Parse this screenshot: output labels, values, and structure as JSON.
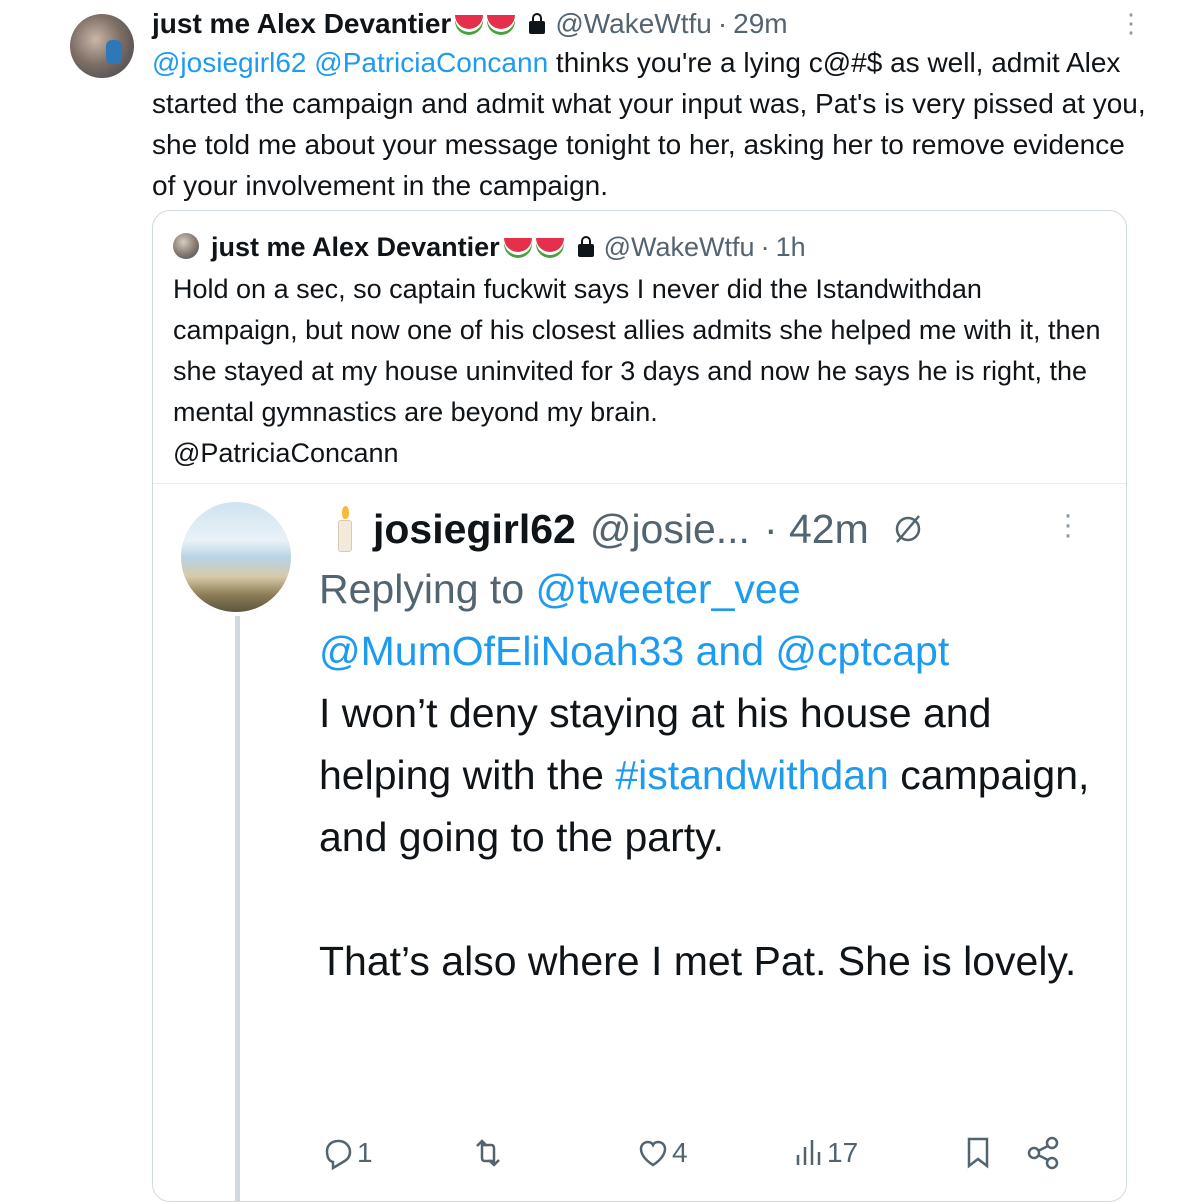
{
  "tweet": {
    "author_name": "just me Alex Devantier",
    "handle": "@WakeWtfu",
    "time_sep": "·",
    "time": "29m",
    "mentions": [
      "@josiegirl62",
      "@PatriciaConcann"
    ],
    "text": " thinks you're a lying c@#$ as well, admit Alex started the campaign and admit what your input was, Pat's is very pissed at you, she told me about your message tonight to her, asking her to remove evidence of your involvement in the campaign."
  },
  "quoted": {
    "author_name": "just me Alex Devantier",
    "handle": "@WakeWtfu",
    "time_sep": "·",
    "time": "1h",
    "text": "Hold on a sec, so captain fuckwit says I never did the Istandwithdan campaign, but now one of his closest allies admits she helped me with it, then she stayed at my house uninvited for 3 days and now he says he is right, the mental gymnastics are beyond my brain.",
    "mention": "@PatriciaConcann"
  },
  "inner": {
    "author_name": "josiegirl62",
    "handle": "@josie...",
    "time": "· 42m",
    "replying_prefix": "Replying to ",
    "replying_1": "@tweeter_vee",
    "replying_2": "@MumOfEliNoah33",
    "replying_and": " and ",
    "replying_3": "@cptcapt",
    "body_part1": "I won’t deny staying at his house and helping with the ",
    "hashtag": "#istandwithdan",
    "body_part2": " campaign, and going to the party.\n\nThat’s also where I met Pat. She is lovely.",
    "actions": {
      "replies": "1",
      "likes": "4",
      "views": "17"
    }
  },
  "icons": [
    "more-vert-icon",
    "lock-icon",
    "watermelon-icon",
    "candle-icon",
    "mute-icon",
    "reply-icon",
    "retweet-icon",
    "like-icon",
    "views-icon",
    "bookmark-icon",
    "share-icon"
  ],
  "colors": {
    "link": "#1d9bf0",
    "muted": "#536471",
    "border": "#cfd9de"
  }
}
